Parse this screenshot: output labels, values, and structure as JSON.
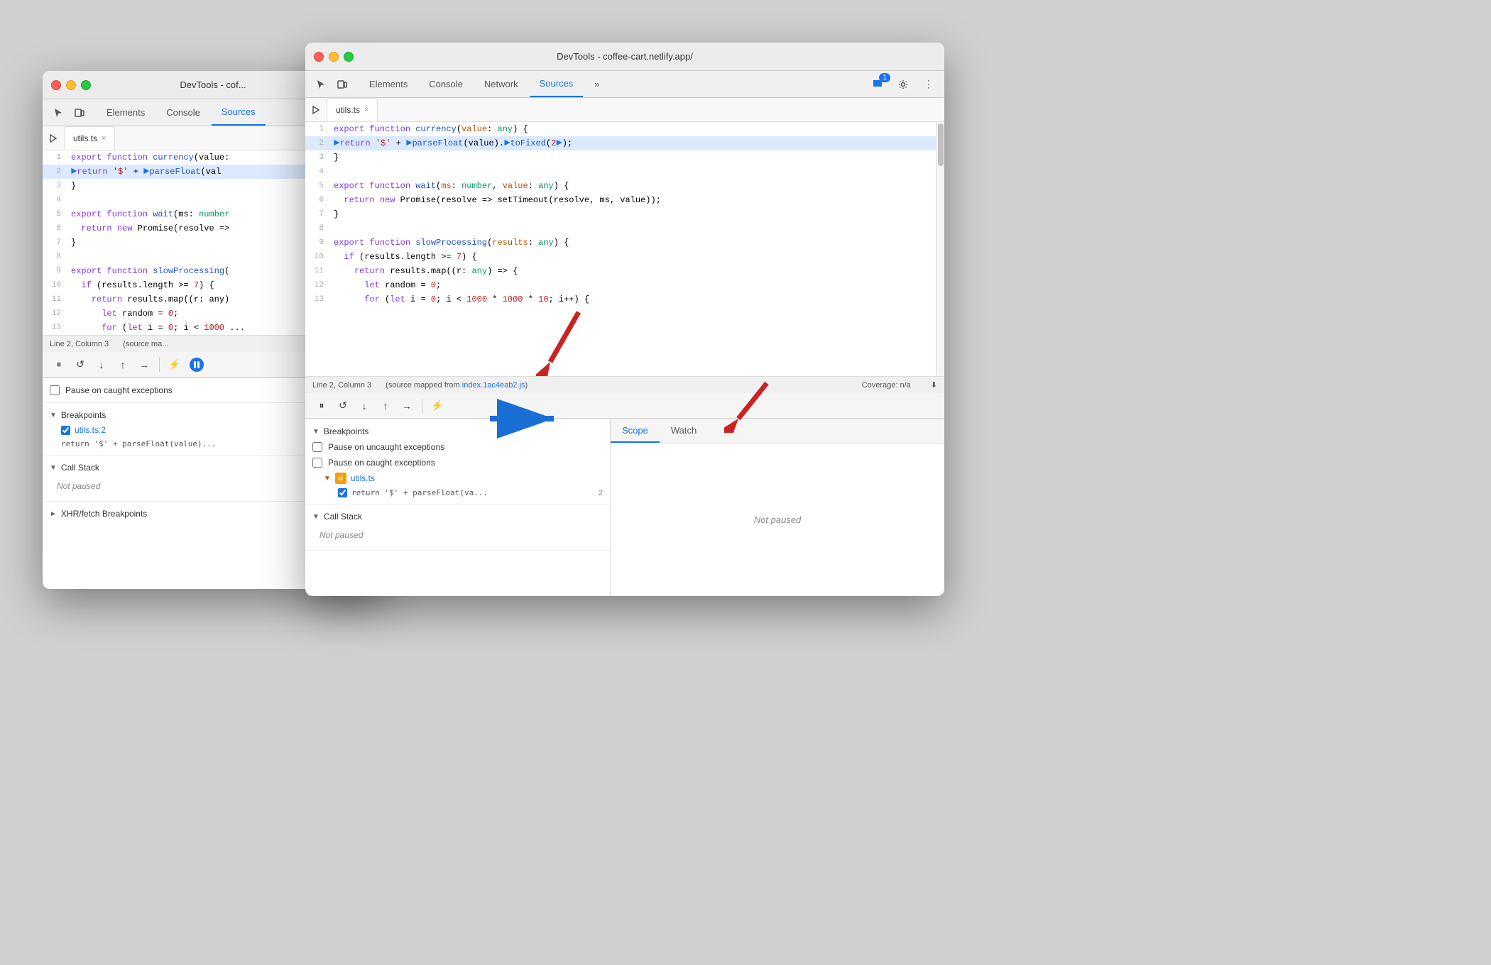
{
  "windows": {
    "back": {
      "title": "DevTools - cof...",
      "tabs": [
        "Elements",
        "Console",
        "Sources"
      ],
      "active_tab": "Sources",
      "file_tab": "utils.ts",
      "status": "Line 2, Column 3",
      "status_right": "(source ma...",
      "code_lines": [
        {
          "num": 1,
          "content": "export function currency(value: "
        },
        {
          "num": 2,
          "content": "  ►return '$' + ►parseFloat(val",
          "highlighted": true
        },
        {
          "num": 3,
          "content": "}"
        },
        {
          "num": 4,
          "content": ""
        },
        {
          "num": 5,
          "content": "export function wait(ms: number"
        },
        {
          "num": 6,
          "content": "  return new Promise(resolve =>"
        },
        {
          "num": 7,
          "content": "}"
        },
        {
          "num": 8,
          "content": ""
        },
        {
          "num": 9,
          "content": "export function slowProcessing("
        },
        {
          "num": 10,
          "content": "  if (results.length >= 7) {"
        },
        {
          "num": 11,
          "content": "    return results.map((r: any)"
        },
        {
          "num": 12,
          "content": "      let random = 0;"
        },
        {
          "num": 13,
          "content": "      for (let i = 0; i < 1000..."
        }
      ],
      "debugger_controls": [
        "pause",
        "resume",
        "step_over",
        "step_into",
        "step_out",
        "deactivate"
      ],
      "pause_on_caught": "Pause on caught exceptions",
      "sections": {
        "breakpoints": {
          "label": "Breakpoints",
          "items": [
            {
              "file": "utils.ts:2",
              "code": "return '$' + parseFloat(value)..."
            }
          ]
        },
        "call_stack": {
          "label": "Call Stack",
          "status": "Not paused"
        },
        "xhr": {
          "label": "XHR/fetch Breakpoints"
        }
      }
    },
    "front": {
      "title": "DevTools - coffee-cart.netlify.app/",
      "tabs": [
        "Elements",
        "Console",
        "Network",
        "Sources"
      ],
      "active_tab": "Sources",
      "file_tab": "utils.ts",
      "status": "Line 2, Column 3",
      "status_right": "(source mapped from index.1ac4eab2.js)",
      "coverage": "Coverage: n/a",
      "code_lines": [
        {
          "num": 1,
          "content": "export function currency(value: any) {"
        },
        {
          "num": 2,
          "content": "  ►return '$' + ►parseFloat(value).►toFixed(2►);",
          "highlighted": true
        },
        {
          "num": 3,
          "content": "}"
        },
        {
          "num": 4,
          "content": ""
        },
        {
          "num": 5,
          "content": "export function wait(ms: number, value: any) {"
        },
        {
          "num": 6,
          "content": "  return new Promise(resolve => setTimeout(resolve, ms, value));"
        },
        {
          "num": 7,
          "content": "}"
        },
        {
          "num": 8,
          "content": ""
        },
        {
          "num": 9,
          "content": "export function slowProcessing(results: any) {"
        },
        {
          "num": 10,
          "content": "  if (results.length >= 7) {"
        },
        {
          "num": 11,
          "content": "    return results.map((r: any) => {"
        },
        {
          "num": 12,
          "content": "      let random = 0;"
        },
        {
          "num": 13,
          "content": "      for (let i = 0; i < 1000 * 1000 * 10; i++) {"
        }
      ],
      "sections": {
        "breakpoints": {
          "label": "Breakpoints",
          "pause_uncaught": "Pause on uncaught exceptions",
          "pause_caught": "Pause on caught exceptions",
          "file": "utils.ts",
          "bp_item": "return '$' + parseFloat(va...",
          "bp_line": "2"
        },
        "call_stack": {
          "label": "Call Stack",
          "status": "Not paused"
        }
      },
      "scope_panel": {
        "tabs": [
          "Scope",
          "Watch"
        ],
        "active_tab": "Scope",
        "status": "Not paused"
      },
      "chat_badge": "1"
    }
  },
  "arrows": {
    "blue_label": "→",
    "red_labels": [
      "↙",
      "↙"
    ]
  }
}
